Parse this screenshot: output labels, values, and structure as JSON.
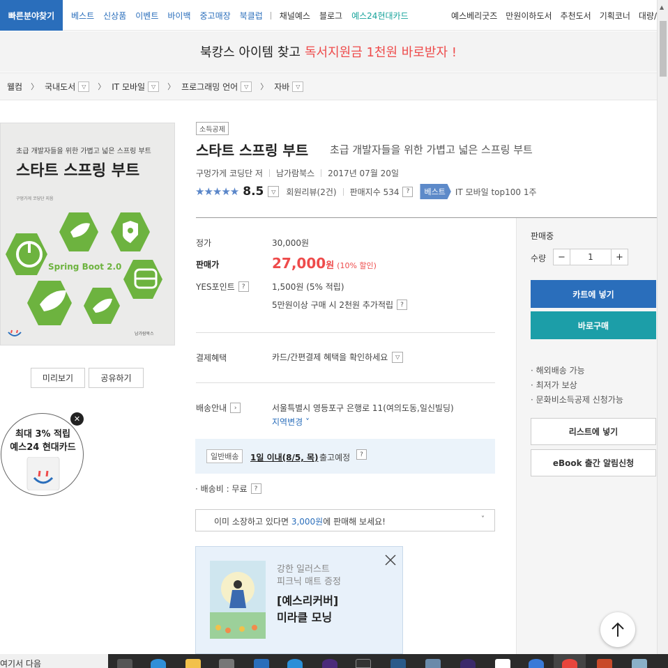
{
  "topnav": {
    "quick": "빠른분야찾기",
    "left_items": [
      "베스트",
      "신상품",
      "이벤트",
      "바이백",
      "중고매장",
      "북클럽"
    ],
    "mid_items": [
      "채널예스",
      "블로그"
    ],
    "card_item": "예스24현대카드",
    "right_items": [
      "예스베리굿즈",
      "만원이하도서",
      "추천도서",
      "기획코너",
      "대량/"
    ]
  },
  "promo": {
    "text_dark": "북캉스 아이템 찾고",
    "text_red": "독서지원금 1천원 바로받자 !"
  },
  "breadcrumb": {
    "home": "웰컴",
    "items": [
      "국내도서",
      "IT 모바일",
      "프로그래밍 언어",
      "자바"
    ]
  },
  "cover": {
    "subtitle": "초급 개발자들을 위한 가볍고 넓은 스프링 부트",
    "title": "스타트 스프링 부트",
    "author": "구멍가게 코딩단 지음",
    "spring_label": "Spring Boot 2.0",
    "publisher": "남가람북스"
  },
  "left_buttons": {
    "preview": "미리보기",
    "share": "공유하기"
  },
  "card_promo": {
    "line1": "최대 3% 적립",
    "line2": "예스24 현대카드",
    "close": "✕"
  },
  "product": {
    "badge": "소득공제",
    "title": "스타트 스프링 부트",
    "subtitle": "초급 개발자들을 위한 가볍고 넓은 스프링 부트",
    "author": "구멍가게 코딩단 저",
    "publisher": "남가람북스",
    "date": "2017년 07월 20일",
    "stars": "★★★★★",
    "rating": "8.5",
    "reviews": "회원리뷰(2건)",
    "sales_index": "판매지수 534",
    "best_tag": "베스트",
    "rank": "IT 모바일 top100 1주"
  },
  "price": {
    "list_label": "정가",
    "list_value": "30,000원",
    "sale_label": "판매가",
    "sale_value": "27,000",
    "sale_unit": "원",
    "discount": "(10% 할인)",
    "point_label": "YES포인트",
    "point_value": "1,500원 (5% 적립)",
    "extra_point": "5만원이상 구매 시 2천원 추가적립",
    "pay_label": "결제혜택",
    "pay_value": "카드/간편결제 혜택을 확인하세요",
    "ship_label": "배송안내",
    "ship_address": "서울특별시 영등포구 은행로 11(여의도동,일신빌딩)",
    "ship_change": "지역변경",
    "ship_type": "일반배송",
    "ship_date": "1일 이내(8/5, 목)",
    "ship_suffix": "출고예정",
    "ship_fee": "· 배송비 : 무료",
    "sell_prefix": "이미 소장하고 있다면",
    "sell_amount": "3,000원",
    "sell_suffix": "에 판매해 보세요!"
  },
  "ad": {
    "line1": "강한 일러스트",
    "line2": "피크닉 매트 증정",
    "title1": "[예스리커버]",
    "title2": "미라클 모닝"
  },
  "side": {
    "status": "판매중",
    "qty_label": "수량",
    "qty_value": "1",
    "minus": "−",
    "plus": "+",
    "cart": "카트에 넣기",
    "buy": "바로구매",
    "benefits": [
      "· 해외배송 가능",
      "· 최저가 보상",
      "· 문화비소득공제 신청가능"
    ],
    "wishlist": "리스트에 넣기",
    "ebook": "eBook 출간 알림신청"
  },
  "taskbar": {
    "left_text": "여기서 다음"
  },
  "colors": {
    "brand_blue": "#2a6ebb",
    "teal": "#1c9ea8",
    "red": "#ee4b4b",
    "spring_green": "#6db33f"
  }
}
